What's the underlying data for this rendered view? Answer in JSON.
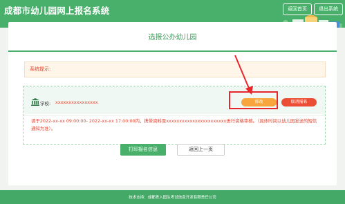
{
  "header": {
    "site_title": "成都市幼儿园网上报名系统",
    "home_button": "返回首页",
    "logout_button": "退出系统"
  },
  "page": {
    "title": "选报公办幼儿园"
  },
  "notice": {
    "label": "系统提示:"
  },
  "school": {
    "label": "学校:",
    "value": "xxxxxxxxxxxxxxxx",
    "modify_button": "修改",
    "cancel_button": "取消报名",
    "note": "请于2022-xx-xx 09:00:00- 2022-xx-xx 17:00:00内，携带资料至xxxxxxxxxxxxxxxxxxxxxxx进行资格审核。（具体时间以幼儿园发送的短信通知为准）。"
  },
  "actions": {
    "print_button": "打印报名信息",
    "back_button": "返回上一页"
  },
  "footer": {
    "text": "技术支持：成都青入园生考试信息开发有限责任公司"
  },
  "colors": {
    "brand_green": "#48b06a",
    "warning_red": "#e2442f",
    "modify_orange": "#f7a53c",
    "cancel_red": "#ea4f36",
    "highlight_red": "#e8262d"
  },
  "icons": {
    "school": "bank-icon",
    "annotation": "arrow-pointer-icon"
  }
}
